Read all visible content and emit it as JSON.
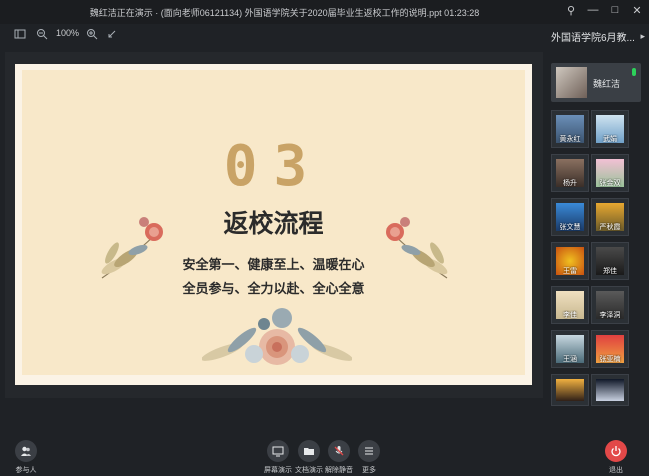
{
  "window": {
    "title": "魏红洁正在演示 · (面向老师06121134) 外国语学院关于2020届毕业生返校工作的说明.ppt 01:23:28",
    "controls": [
      "pin-icon",
      "minimize-icon",
      "maximize-icon",
      "close-icon"
    ]
  },
  "toolbar": {
    "zoom": "100%"
  },
  "slide": {
    "number": "03",
    "title": "返校流程",
    "line1": "安全第一、健康至上、温暖在心",
    "line2": "全员参与、全力以赴、全心全意",
    "colors": {
      "bg": "#f8e8c9",
      "accent": "#c9a366",
      "text": "#2b2b2b"
    }
  },
  "sidebar": {
    "meeting_name": "外国语学院6月教...",
    "host": {
      "name": "魏红洁"
    },
    "participants": [
      {
        "label": "黄永红"
      },
      {
        "label": "武娟"
      },
      {
        "label": "杨升"
      },
      {
        "label": "张金双"
      },
      {
        "label": "张文慧"
      },
      {
        "label": "严秋霞"
      },
      {
        "label": "王雷"
      },
      {
        "label": "郑佳"
      },
      {
        "label": "李佳"
      },
      {
        "label": "李泽洞"
      },
      {
        "label": "王涵"
      },
      {
        "label": "张亚楠"
      }
    ]
  },
  "bottom": {
    "participants": "参与人",
    "screen_share": "屏幕演示",
    "doc_share": "文档演示",
    "unmute": "解除静音",
    "more": "更多",
    "exit": "退出",
    "colors": {
      "exit": "#e24848"
    }
  }
}
